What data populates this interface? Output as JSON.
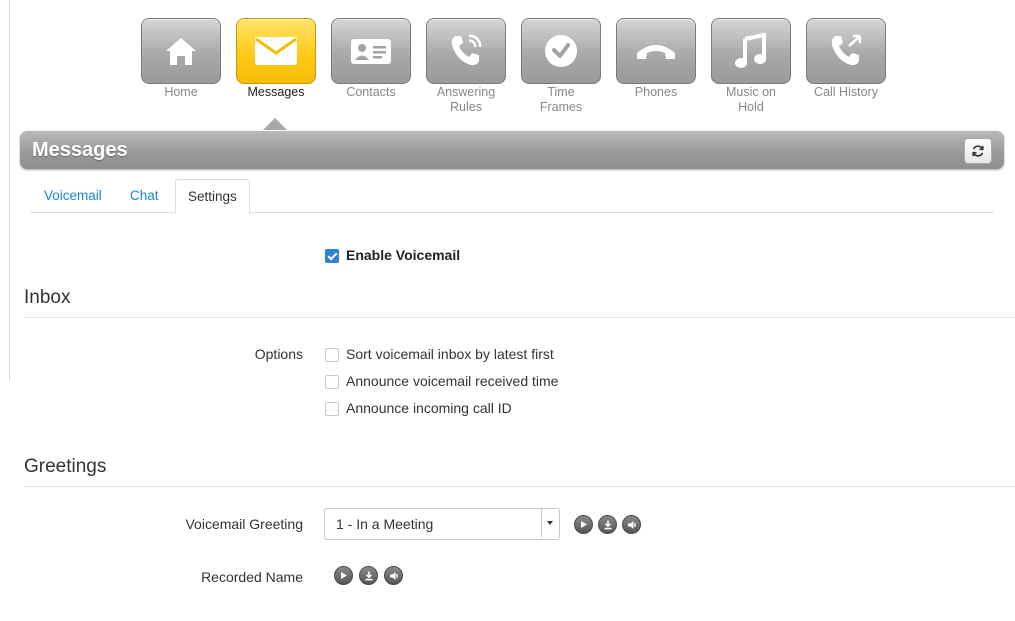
{
  "nav": {
    "items": [
      {
        "label": "Home",
        "icon": "home-icon"
      },
      {
        "label": "Messages",
        "icon": "envelope-icon"
      },
      {
        "label": "Contacts",
        "icon": "contact-card-icon"
      },
      {
        "label": "Answering\nRules",
        "icon": "phone-rules-icon"
      },
      {
        "label": "Time\nFrames",
        "icon": "clock-icon"
      },
      {
        "label": "Phones",
        "icon": "handset-icon"
      },
      {
        "label": "Music on\nHold",
        "icon": "music-note-icon"
      },
      {
        "label": "Call History",
        "icon": "call-history-icon"
      }
    ],
    "active": "Messages"
  },
  "header": {
    "title": "Messages",
    "refresh_icon": "refresh-icon"
  },
  "tabs": {
    "items": [
      {
        "label": "Voicemail"
      },
      {
        "label": "Chat"
      },
      {
        "label": "Settings"
      }
    ],
    "active": "Settings"
  },
  "settings": {
    "enable_voicemail": {
      "label": "Enable Voicemail",
      "checked": true
    },
    "inbox": {
      "title": "Inbox",
      "options_label": "Options",
      "options": [
        {
          "label": "Sort voicemail inbox by latest first",
          "checked": false
        },
        {
          "label": "Announce voicemail received time",
          "checked": false
        },
        {
          "label": "Announce incoming call ID",
          "checked": false
        }
      ]
    },
    "greetings": {
      "title": "Greetings",
      "voicemail_greeting_label": "Voicemail Greeting",
      "voicemail_greeting_value": "1 - In a Meeting",
      "recorded_name_label": "Recorded Name",
      "media_icons": [
        "play-icon",
        "download-icon",
        "speaker-icon"
      ]
    }
  },
  "colors": {
    "active_tile": "#ffcb17",
    "tile": "#a9a9a9",
    "link": "#1a86c8",
    "checkbox_checked": "#2f82d6"
  }
}
